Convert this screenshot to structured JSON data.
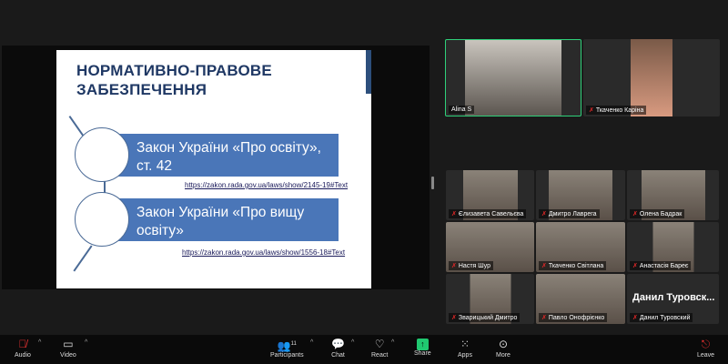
{
  "slide": {
    "title_line1": "НОРМАТИВНО-ПРАВОВЕ",
    "title_line2": "ЗАБЕЗПЕЧЕННЯ",
    "item1": "Закон України «Про освіту», ст. 42",
    "link1": "https://zakon.rada.gov.ua/laws/show/2145-19#Text",
    "item2": "Закон України «Про вищу освіту»",
    "link2": "https://zakon.rada.gov.ua/laws/show/1556-18#Text"
  },
  "speakers": [
    {
      "name": "Alina S"
    },
    {
      "name": "Tkachenko Karina",
      "display": "Ткаченко Каріна"
    }
  ],
  "gallery": [
    {
      "name": "Єлизавета Савельєва"
    },
    {
      "name": "Дмитро Лаврега"
    },
    {
      "name": "Олена Бадрак"
    },
    {
      "name": "Настя Шур"
    },
    {
      "name": "Ткаченко Світлана"
    },
    {
      "name": "Анастасія Бареє"
    },
    {
      "name": "Зварицький Дмитро"
    },
    {
      "name": "Павло Онофрієнко"
    },
    {
      "name": "Данил Туровский",
      "big": "Данил Туровск..."
    }
  ],
  "toolbar": {
    "audio": "Audio",
    "video": "Video",
    "participants": "Participants",
    "participants_count": "11",
    "chat": "Chat",
    "react": "React",
    "share": "Share",
    "apps": "Apps",
    "more": "More",
    "leave": "Leave"
  },
  "colors": {
    "accent": "#2fd07a",
    "share": "#20c870",
    "slide_blue": "#4a76b8",
    "title": "#1f3864"
  }
}
